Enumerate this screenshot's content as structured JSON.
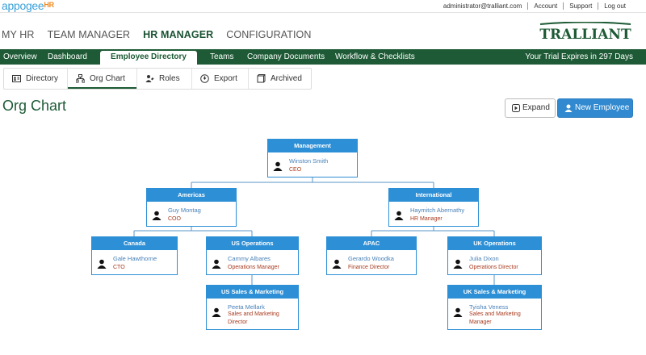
{
  "topbar": {
    "logo_main": "appogee",
    "logo_suffix": "HR",
    "links": [
      "administrator@tralliant.com",
      "Account",
      "Support",
      "Log out"
    ]
  },
  "modules": [
    "MY HR",
    "TEAM MANAGER",
    "HR MANAGER",
    "CONFIGURATION"
  ],
  "active_module": "HR MANAGER",
  "brand": "TRALLIANT",
  "nav": {
    "items": [
      "Overview",
      "Dashboard",
      "Employee Directory",
      "Teams",
      "Company Documents",
      "Workflow & Checklists"
    ],
    "trial": "Your Trial Expires in 297 Days"
  },
  "subtabs": [
    {
      "label": "Directory",
      "icon": "id-card-icon"
    },
    {
      "label": "Org Chart",
      "icon": "org-chart-icon"
    },
    {
      "label": "Roles",
      "icon": "user-roles-icon"
    },
    {
      "label": "Export",
      "icon": "export-icon"
    },
    {
      "label": "Archived",
      "icon": "archive-icon"
    }
  ],
  "page_title": "Org Chart",
  "buttons": {
    "expand": "Expand",
    "new_employee": "New Employee"
  },
  "org": {
    "management": {
      "team": "Management",
      "name": "Winston Smith",
      "role": "CEO"
    },
    "americas": {
      "team": "Americas",
      "name": "Guy Montag",
      "role": "COO"
    },
    "international": {
      "team": "International",
      "name": "Haymitch Abernathy",
      "role": "HR Manager"
    },
    "canada": {
      "team": "Canada",
      "name": "Gale Hawthorne",
      "role": "CTO"
    },
    "us_operations": {
      "team": "US Operations",
      "name": "Cammy Albares",
      "role": "Operations Manager"
    },
    "apac": {
      "team": "APAC",
      "name": "Gerardo Woodka",
      "role": "Finance Director"
    },
    "uk_operations": {
      "team": "UK Operations",
      "name": "Julia Dixon",
      "role": "Operations Director"
    },
    "us_sales": {
      "team": "US Sales & Marketing",
      "name": "Peeta Mellark",
      "role": "Sales and Marketing Director"
    },
    "uk_sales": {
      "team": "UK Sales & Marketing",
      "name": "Tyisha Veness",
      "role": "Sales and Marketing Manager"
    }
  },
  "colors": {
    "brand_green": "#1d5a35",
    "node_blue": "#2d8fd5",
    "role_red": "#a83a1e",
    "logo_blue": "#3aa0d8",
    "logo_orange": "#f08a24"
  }
}
